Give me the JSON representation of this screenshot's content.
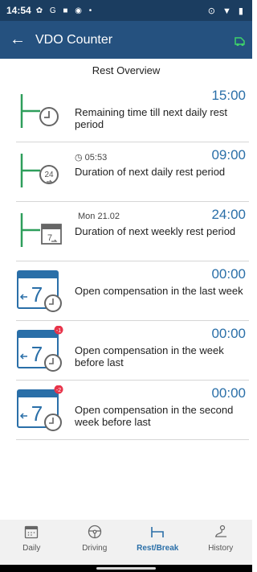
{
  "status_bar": {
    "time": "14:54",
    "left_icons": "✿ G ■ ◉ •",
    "right_icons": "⊙ ▼ ▮"
  },
  "app_bar": {
    "back_icon": "arrow-left-icon",
    "title": "VDO Counter",
    "status_icon": "truck-icon"
  },
  "overview": {
    "title": "Rest Overview",
    "rows": [
      {
        "icon": "rest-clock-icon",
        "sub": "",
        "value": "15:00",
        "label": "Remaining time till next daily rest period"
      },
      {
        "icon": "rest-24h-icon",
        "sub": "05:53",
        "value": "09:00",
        "label": "Duration of next daily rest period"
      },
      {
        "icon": "weekly-rest-icon",
        "sub": "Mon 21.02",
        "value": "24:00",
        "label": "Duration of next weekly rest period"
      },
      {
        "icon": "calendar-compensation-icon",
        "badge": "",
        "sub": "",
        "value": "00:00",
        "label": "Open compensation in the last week"
      },
      {
        "icon": "calendar-compensation-icon",
        "badge": "-1",
        "sub": "",
        "value": "00:00",
        "label": "Open compensation in the week before last"
      },
      {
        "icon": "calendar-compensation-icon",
        "badge": "-2",
        "sub": "",
        "value": "00:00",
        "label": "Open compensation in the second week before last"
      }
    ]
  },
  "nav": {
    "items": [
      {
        "label": "Daily",
        "icon": "calendar-icon",
        "active": false
      },
      {
        "label": "Driving",
        "icon": "steering-wheel-icon",
        "active": false
      },
      {
        "label": "Rest/Break",
        "icon": "bed-icon",
        "active": true
      },
      {
        "label": "History",
        "icon": "history-route-icon",
        "active": false
      }
    ]
  },
  "colors": {
    "status_bar": "#1b3d60",
    "app_bar": "#25517f",
    "accent": "#2a6fa8",
    "rest_green": "#2e9e5b",
    "badge_red": "#e8344a"
  }
}
